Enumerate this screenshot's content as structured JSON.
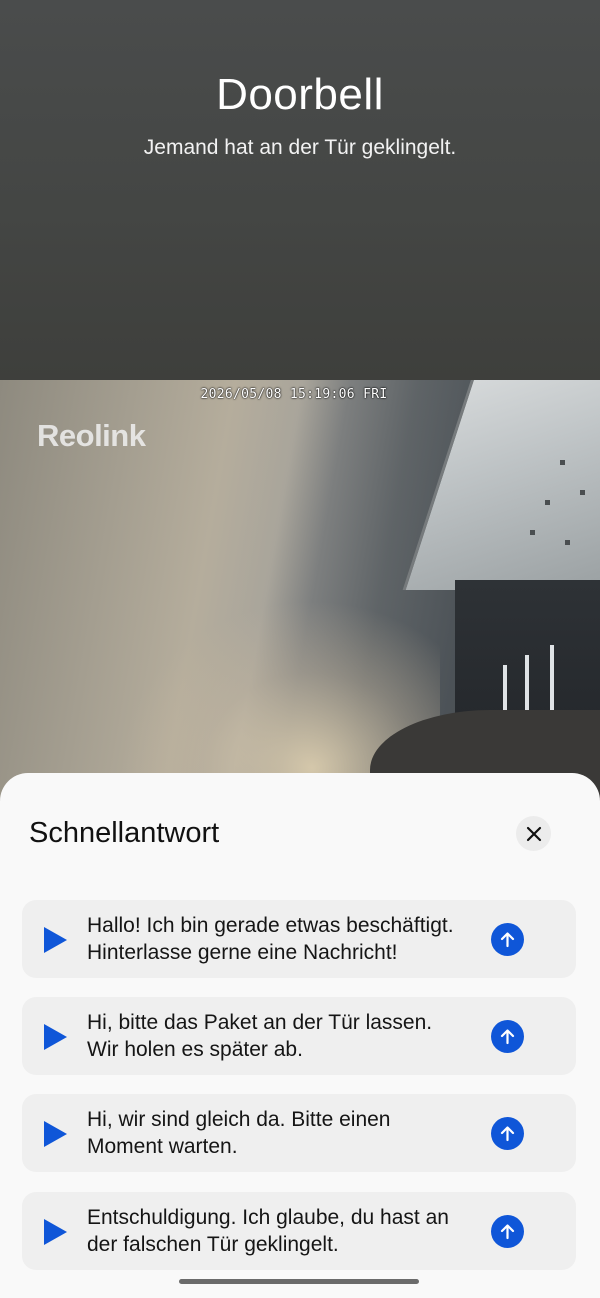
{
  "notification": {
    "title": "Doorbell",
    "message": "Jemand hat an der Tür geklingelt."
  },
  "camera": {
    "timestamp": "2026/05/08 15:19:06 FRI",
    "brand": "Reolink"
  },
  "quick_reply": {
    "title": "Schnellantwort",
    "close_icon": "close-icon",
    "items": [
      {
        "line1": "Hallo! Ich bin gerade etwas beschäftigt.",
        "line2": "Hinterlasse gerne eine Nachricht!"
      },
      {
        "line1": "Hi, bitte das Paket an der Tür lassen.",
        "line2": "Wir holen es später ab."
      },
      {
        "line1": "Hi, wir sind gleich da. Bitte einen",
        "line2": "Moment warten."
      },
      {
        "line1": "Entschuldigung. Ich glaube, du hast an",
        "line2": "der falschen Tür geklingelt."
      }
    ]
  },
  "colors": {
    "accent": "#0f56d8",
    "sheet_background": "#f9f9f9",
    "item_background": "#efefef"
  }
}
